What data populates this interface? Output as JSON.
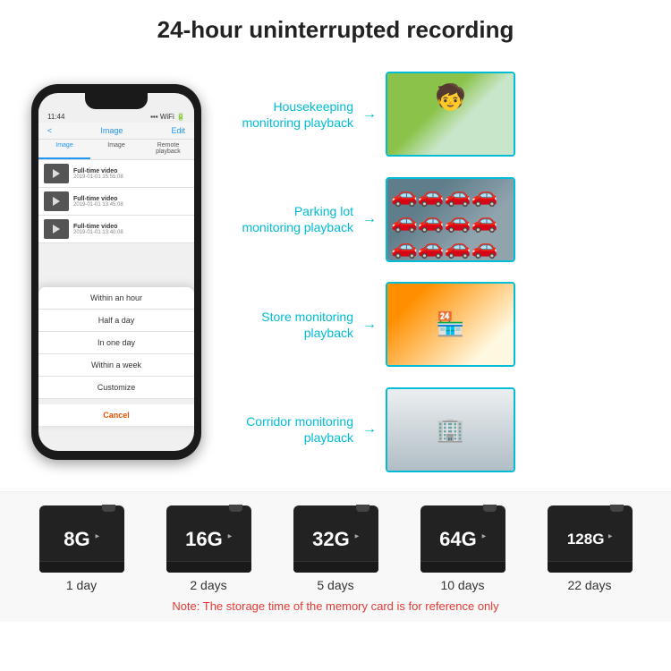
{
  "header": {
    "title": "24-hour uninterrupted recording"
  },
  "phone": {
    "time": "11:44",
    "nav_back": "<",
    "nav_title": "Image",
    "nav_edit": "Edit",
    "tabs": [
      "Image",
      "Image",
      "Remote playback"
    ],
    "list_items": [
      {
        "title": "Full-time video",
        "date": "2019-01-01 15:55:08"
      },
      {
        "title": "Full-time video",
        "date": "2019-01-01 13:45:08"
      },
      {
        "title": "Full-time video",
        "date": "2019-01-01 13:40:08"
      }
    ],
    "dropdown": {
      "items": [
        "Within an hour",
        "Half a day",
        "In one day",
        "Within a week",
        "Customize"
      ],
      "cancel": "Cancel"
    }
  },
  "monitoring": [
    {
      "label": "Housekeeping\nmonitoring playback",
      "type": "housekeeping"
    },
    {
      "label": "Parking lot\nmonitoring playback",
      "type": "parking"
    },
    {
      "label": "Store monitoring\nplayback",
      "type": "store"
    },
    {
      "label": "Corridor monitoring\nplayback",
      "type": "corridor"
    }
  ],
  "sd_cards": [
    {
      "size": "8G",
      "days": "1 day"
    },
    {
      "size": "16G",
      "days": "2 days"
    },
    {
      "size": "32G",
      "days": "5 days"
    },
    {
      "size": "64G",
      "days": "10 days"
    },
    {
      "size": "128G",
      "days": "22 days"
    }
  ],
  "note": "Note: The storage time of the memory card is for reference only"
}
